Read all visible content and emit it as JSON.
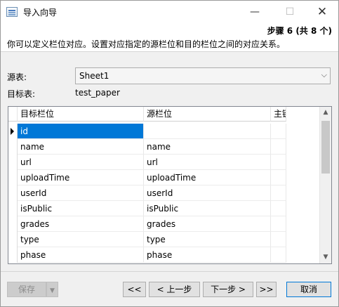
{
  "window": {
    "title": "导入向导",
    "min_glyph": "—",
    "max_glyph": "☐",
    "close_glyph": "✕"
  },
  "header": {
    "step": "步骤 6 (共 8 个)",
    "description": "你可以定义栏位对应。设置对应指定的源栏位和目的栏位之间的对应关系。"
  },
  "form": {
    "source_label": "源表:",
    "source_value": "Sheet1",
    "target_label": "目标表:",
    "target_value": "test_paper"
  },
  "grid": {
    "columns": [
      "目标栏位",
      "源栏位",
      "主键"
    ],
    "rows": [
      [
        "id",
        ""
      ],
      [
        "name",
        "name"
      ],
      [
        "url",
        "url"
      ],
      [
        "uploadTime",
        "uploadTime"
      ],
      [
        "userId",
        "userId"
      ],
      [
        "isPublic",
        "isPublic"
      ],
      [
        "grades",
        "grades"
      ],
      [
        "type",
        "type"
      ],
      [
        "phase",
        "phase"
      ]
    ]
  },
  "footer": {
    "save_label": "保存",
    "first_label": "<<",
    "prev_label": "< 上一步",
    "next_label": "下一步 >",
    "last_label": ">>",
    "cancel_label": "取消"
  }
}
